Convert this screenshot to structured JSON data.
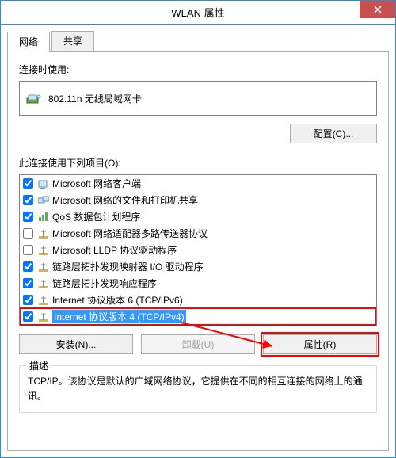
{
  "title": "WLAN 属性",
  "tabs": {
    "network": "网络",
    "share": "共享"
  },
  "connect_using_label": "连接时使用:",
  "adapter": {
    "name": "802.11n 无线局域网卡"
  },
  "configure_btn": "配置(C)...",
  "items_label": "此连接使用下列项目(O):",
  "items": [
    {
      "checked": true,
      "label": "Microsoft 网络客户端",
      "icon": "client"
    },
    {
      "checked": true,
      "label": "Microsoft 网络的文件和打印机共享",
      "icon": "share"
    },
    {
      "checked": true,
      "label": "QoS 数据包计划程序",
      "icon": "qos"
    },
    {
      "checked": false,
      "label": "Microsoft 网络适配器多路传送器协议",
      "icon": "proto"
    },
    {
      "checked": false,
      "label": "Microsoft LLDP 协议驱动程序",
      "icon": "proto"
    },
    {
      "checked": true,
      "label": "链路层拓扑发现映射器 I/O 驱动程序",
      "icon": "proto"
    },
    {
      "checked": true,
      "label": "链路层拓扑发现响应程序",
      "icon": "proto"
    },
    {
      "checked": true,
      "label": "Internet 协议版本 6 (TCP/IPv6)",
      "icon": "proto"
    },
    {
      "checked": true,
      "label": "Internet 协议版本 4 (TCP/IPv4)",
      "icon": "proto",
      "selected": true
    }
  ],
  "install_btn": "安装(N)...",
  "uninstall_btn": "卸载(U)",
  "properties_btn": "属性(R)",
  "desc_group": "描述",
  "desc_text": "TCP/IP。该协议是默认的广域网络协议，它提供在不同的相互连接的网络上的通讯。"
}
